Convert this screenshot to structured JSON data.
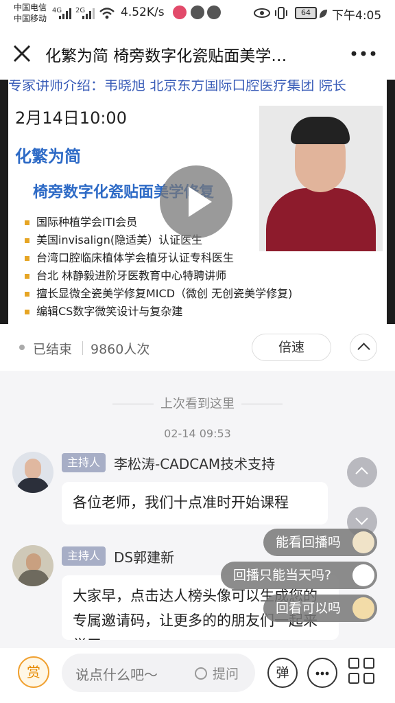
{
  "status_bar": {
    "carrier1": "中国电信",
    "carrier2": "中国移动",
    "net1": "4G",
    "net2": "2G",
    "speed": "4.52K/s",
    "battery": "64",
    "time": "下午4:05"
  },
  "header": {
    "title": "化繁为简 椅旁数字化瓷贴面美学…",
    "close_icon": "close-icon",
    "more_icon": "more-icon"
  },
  "video": {
    "slide_top": "专家讲师介绍：韦晓旭 北京东方国际口腔医疗集团 院长",
    "date": "2月14日10:00",
    "headline": "化繁为简",
    "subheadline": "椅旁数字化瓷贴面美学修复",
    "bullets": [
      "国际种植学会ITI会员",
      "美国invisalign(隐适美）认证医生",
      "台湾口腔临床植体学会植牙认证专科医生",
      "台北 林静毅进阶牙医教育中心特聘讲师",
      "擅长显微全瓷美学修复MICD（微创 无创瓷美学修复)",
      "编辑CS数字微笑设计与复杂建"
    ]
  },
  "info": {
    "status": "已结束",
    "views": "9860人次",
    "speed_button": "倍速"
  },
  "chat": {
    "last_seen": "上次看到这里",
    "timestamp": "02-14 09:53",
    "messages": [
      {
        "badge": "主持人",
        "sender": "李松涛-CADCAM技术支持",
        "text": "各位老师，我们十点准时开始课程"
      },
      {
        "badge": "主持人",
        "sender": "DS郭建新",
        "text": "大家早，点击达人榜头像可以生成您的专属邀请码，让更多的的朋友们一起来学习"
      }
    ],
    "danmu": [
      "能看回播吗",
      "回播只能当天吗?",
      "回看可以吗"
    ]
  },
  "bottom_bar": {
    "reward": "赏",
    "placeholder": "说点什么吧～",
    "question": "提问",
    "danmu_button": "弹",
    "chat_icon": "chat-icon",
    "grid_icon": "grid-icon"
  },
  "colors": {
    "accent_blue": "#2d6ac6",
    "badge": "#a7aec6",
    "reward_orange": "#e68a00"
  }
}
